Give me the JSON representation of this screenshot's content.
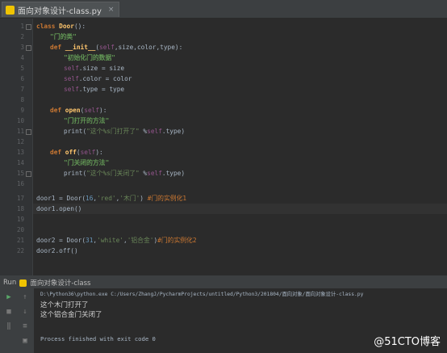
{
  "tab": {
    "label": "面向对象设计-class.py",
    "close": "×"
  },
  "gutter": {
    "lines": [
      "1",
      "2",
      "3",
      "4",
      "5",
      "6",
      "7",
      "8",
      "9",
      "10",
      "11",
      "12",
      "13",
      "14",
      "15",
      "16",
      "17",
      "18",
      "19",
      "20",
      "21",
      "22"
    ]
  },
  "code": {
    "l1_kw": "class ",
    "l1_name": "Door",
    "l1_rest": "():",
    "l2_doc": "\"门的类\"",
    "l3_kw": "def ",
    "l3_fn": "__init__",
    "l3_a": "(",
    "l3_self": "self",
    "l3_b": ",size,color,type):",
    "l4_doc": "\"初始化门的数据\"",
    "l5_self": "self",
    "l5_rest": ".size = size",
    "l6_self": "self",
    "l6_rest": ".color = color",
    "l7_self": "self",
    "l7_rest": ".type = type",
    "l9_kw": "def ",
    "l9_fn": "open",
    "l9_a": "(",
    "l9_self": "self",
    "l9_b": "):",
    "l10_doc": "\"门打开的方法\"",
    "l11_a": "print(",
    "l11_str": "\"这个%s门打开了\"",
    "l11_b": " %",
    "l11_self": "self",
    "l11_c": ".type)",
    "l13_kw": "def ",
    "l13_fn": "off",
    "l13_a": "(",
    "l13_self": "self",
    "l13_b": "):",
    "l14_doc": "\"门关闭的方法\"",
    "l15_a": "print(",
    "l15_str": "\"这个%s门关闭了\"",
    "l15_b": " %",
    "l15_self": "self",
    "l15_c": ".type)",
    "l17_a": "door1 = Door(",
    "l17_n": "16",
    "l17_b": ",",
    "l17_s1": "'red'",
    "l17_c": ",",
    "l17_s2": "'木门'",
    "l17_d": ") ",
    "l17_cmt": "#门的实例化1",
    "l18": "door1.open()",
    "l21_a": "door2 = Door(",
    "l21_n": "31",
    "l21_b": ",",
    "l21_s1": "'white'",
    "l21_c": ",",
    "l21_s2": "'铝合金'",
    "l21_d": ")",
    "l21_cmt": "#门的实例化2",
    "l22": "door2.off()"
  },
  "run": {
    "label": "Run",
    "config": "面向对象设计-class"
  },
  "console": {
    "cmd": "D:\\Python36\\python.exe C:/Users/ZhangJ/PycharmProjects/untitled/Python3/201804/面向对象/面向对象设计-class.py",
    "out1": "这个木门打开了",
    "out2": "这个铝合金门关闭了",
    "exit": "Process finished with exit code 0"
  },
  "watermark": "@51CTO博客",
  "colors": {
    "background": "#2b2b2b",
    "keyword": "#cc7832",
    "string": "#6a8759",
    "self": "#94558d",
    "function": "#ffc66d"
  }
}
